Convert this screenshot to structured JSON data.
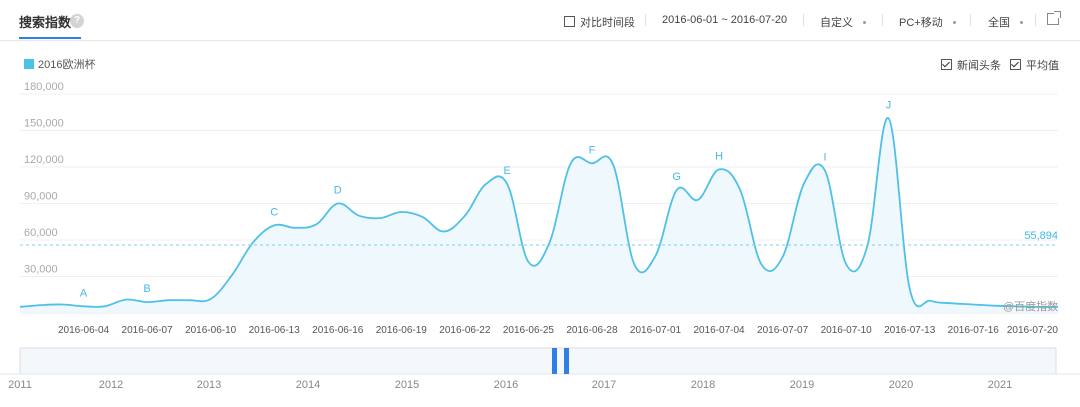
{
  "header": {
    "tab_title": "搜索指数",
    "help_label": "?",
    "compare_label": "对比时间段",
    "date_range": "2016-06-01 ~ 2016-07-20",
    "custom_label": "自定义",
    "device_label": "PC+移动",
    "region_label": "全国"
  },
  "legend": {
    "series_name": "2016欧洲杯",
    "series_color": "#4fc0e8"
  },
  "options": {
    "news_label": "新闻头条",
    "avg_label": "平均值"
  },
  "watermark": "@百度指数",
  "timeline": {
    "years": [
      "2011",
      "2012",
      "2013",
      "2014",
      "2015",
      "2016",
      "2017",
      "2018",
      "2019",
      "2020",
      "2021"
    ]
  },
  "chart_data": {
    "type": "area",
    "series": [
      {
        "name": "2016欧洲杯",
        "color": "#4fc0e8"
      }
    ],
    "y_ticks": [
      30000,
      60000,
      90000,
      120000,
      150000,
      180000
    ],
    "y_tick_labels": [
      "30,000",
      "60,000",
      "90,000",
      "120,000",
      "150,000",
      "180,000"
    ],
    "ylim": [
      0,
      180000
    ],
    "xlim": [
      "2016-06-01",
      "2016-07-20"
    ],
    "x_tick_labels": [
      "2016-06-04",
      "2016-06-07",
      "2016-06-10",
      "2016-06-13",
      "2016-06-16",
      "2016-06-19",
      "2016-06-22",
      "2016-06-25",
      "2016-06-28",
      "2016-07-01",
      "2016-07-04",
      "2016-07-07",
      "2016-07-10",
      "2016-07-13",
      "2016-07-16",
      "2016-07-20"
    ],
    "x": [
      "2016-06-01",
      "2016-06-02",
      "2016-06-03",
      "2016-06-04",
      "2016-06-05",
      "2016-06-06",
      "2016-06-07",
      "2016-06-08",
      "2016-06-09",
      "2016-06-10",
      "2016-06-11",
      "2016-06-12",
      "2016-06-13",
      "2016-06-14",
      "2016-06-15",
      "2016-06-16",
      "2016-06-17",
      "2016-06-18",
      "2016-06-19",
      "2016-06-20",
      "2016-06-21",
      "2016-06-22",
      "2016-06-23",
      "2016-06-24",
      "2016-06-25",
      "2016-06-26",
      "2016-06-27",
      "2016-06-28",
      "2016-06-29",
      "2016-06-30",
      "2016-07-01",
      "2016-07-02",
      "2016-07-03",
      "2016-07-04",
      "2016-07-05",
      "2016-07-06",
      "2016-07-07",
      "2016-07-08",
      "2016-07-09",
      "2016-07-10",
      "2016-07-11",
      "2016-07-12",
      "2016-07-13",
      "2016-07-14",
      "2016-07-15",
      "2016-07-16",
      "2016-07-17",
      "2016-07-18",
      "2016-07-19",
      "2016-07-20"
    ],
    "values": [
      5000,
      6500,
      7000,
      5500,
      5500,
      11000,
      9000,
      10500,
      10500,
      11500,
      31000,
      58000,
      72000,
      70000,
      73000,
      90000,
      80000,
      78000,
      83000,
      79000,
      67000,
      80000,
      106000,
      106000,
      42000,
      58000,
      123000,
      123000,
      122000,
      40000,
      47000,
      101000,
      93000,
      118000,
      101000,
      40000,
      46000,
      106000,
      117000,
      40000,
      55000,
      160000,
      20000,
      10000,
      8000,
      7000,
      6000,
      5500,
      5000,
      5000
    ],
    "average": 55894,
    "average_label": "55,894",
    "annotations": [
      {
        "label": "A",
        "date": "2016-06-04"
      },
      {
        "label": "B",
        "date": "2016-06-07"
      },
      {
        "label": "C",
        "date": "2016-06-13"
      },
      {
        "label": "D",
        "date": "2016-06-16"
      },
      {
        "label": "E",
        "date": "2016-06-24"
      },
      {
        "label": "F",
        "date": "2016-06-28"
      },
      {
        "label": "G",
        "date": "2016-07-02"
      },
      {
        "label": "H",
        "date": "2016-07-04"
      },
      {
        "label": "I",
        "date": "2016-07-09"
      },
      {
        "label": "J",
        "date": "2016-07-12"
      }
    ],
    "grid": true,
    "legend_position": "top-left"
  }
}
